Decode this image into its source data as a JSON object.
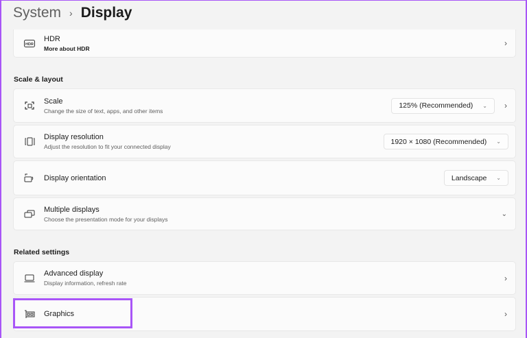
{
  "breadcrumb": {
    "parent": "System",
    "separator": "›",
    "current": "Display"
  },
  "hdr": {
    "title": "HDR",
    "subtitle": "More about HDR",
    "icon": "hdr-icon"
  },
  "sections": {
    "scale_layout": "Scale & layout",
    "related": "Related settings"
  },
  "scale": {
    "title": "Scale",
    "subtitle": "Change the size of text, apps, and other items",
    "value": "125% (Recommended)"
  },
  "resolution": {
    "title": "Display resolution",
    "subtitle": "Adjust the resolution to fit your connected display",
    "value": "1920 × 1080 (Recommended)"
  },
  "orientation": {
    "title": "Display orientation",
    "value": "Landscape"
  },
  "multiple": {
    "title": "Multiple displays",
    "subtitle": "Choose the presentation mode for your displays"
  },
  "advanced": {
    "title": "Advanced display",
    "subtitle": "Display information, refresh rate"
  },
  "graphics": {
    "title": "Graphics"
  },
  "colors": {
    "highlight": "#a855f7"
  }
}
